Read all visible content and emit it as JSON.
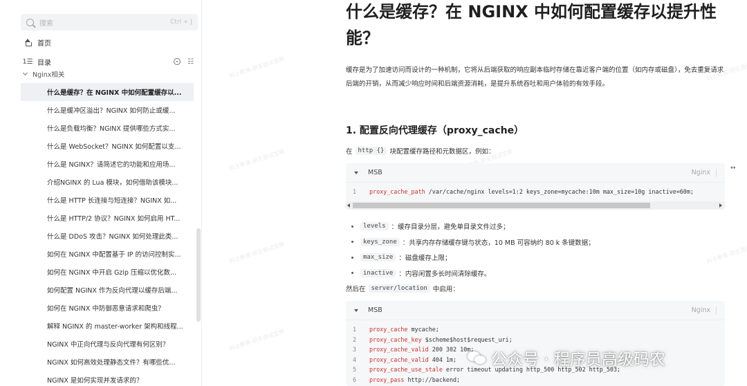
{
  "sidebar": {
    "search_placeholder": "搜索",
    "search_shortcut": "Ctrl + J",
    "home_label": "首页",
    "toc_label": "目录",
    "group_label": "Nginx相关",
    "items": [
      {
        "label": "什么是缓存？在 NGINX 中如何配置缓存以...",
        "active": true
      },
      {
        "label": "什么是缓冲区溢出？NGINX 如何防止或缓..."
      },
      {
        "label": "什么是负载均衡？NGINX 提供哪些方式实..."
      },
      {
        "label": "什么是 WebSocket？NGINX 如何配置以支..."
      },
      {
        "label": "什么是 NGINX？请简述它的功能和应用场..."
      },
      {
        "label": "介绍NGINX 的 Lua 模块，如何借助该模块..."
      },
      {
        "label": "什么是 HTTP 长连接与短连接？NGINX 如..."
      },
      {
        "label": "什么是 HTTP/2 协议？NGINX 如何启用 HT..."
      },
      {
        "label": "什么是 DDoS 攻击？NGINX 如何处理此类..."
      },
      {
        "label": "如何在 NGINX 中配置基于 IP 的访问控制实..."
      },
      {
        "label": "如何在 NGINX 中开启 Gzip 压缩以优化数..."
      },
      {
        "label": "如何配置 NGINX 作为反向代理以缓存后端..."
      },
      {
        "label": "如何在 NGINX 中防御恶意请求和爬虫？"
      },
      {
        "label": "解释 NGINX 的 master-worker 架构和线程..."
      },
      {
        "label": "NGINX 中正向代理与反向代理有何区别？"
      },
      {
        "label": "NGINX 如何高效处理静态文件？有哪些优..."
      },
      {
        "label": "NGINX 是如何实现并发请求的？"
      }
    ]
  },
  "watermark_text": "科士教育-研生面试宝典",
  "article": {
    "title": "什么是缓存？在 NGINX 中如何配置缓存以提升性能？",
    "intro": "缓存是为了加速访问而设计的一种机制，它将从后端获取的响应副本临时存储在靠近客户端的位置（如内存或磁盘），免去重复请求后端的开销，从而减少响应时间和后端资源消耗，是提升系统吞吐和用户体验的有效手段。",
    "section1_heading": "1. 配置反向代理缓存（proxy_cache）",
    "line1_prefix": "在",
    "line1_code": "http {}",
    "line1_suffix": "块配置缓存路径和元数据区，例如：",
    "code1": {
      "name": "MSB",
      "lang": "Nginx",
      "lines": [
        {
          "no": "1",
          "kw": "proxy_cache_path",
          "rest": " /var/cache/nginx levels=1:2 keys_zone=mycache:10m max_size=10g inactive=60m;"
        }
      ]
    },
    "bullets": [
      {
        "code": "levels",
        "text": "：缓存目录分层，避免单目录文件过多；"
      },
      {
        "code": "keys_zone",
        "text": "：共享内存存储缓存键与状态，10 MB 可容纳约 80 k 条键数据；"
      },
      {
        "code": "max_size",
        "text": "：磁盘缓存上限；"
      },
      {
        "code": "inactive",
        "text": "：内容闲置多长时间清除缓存。"
      }
    ],
    "line2_prefix": "然后在",
    "line2_code": "server/location",
    "line2_suffix": "中启用：",
    "code2": {
      "name": "MSB",
      "lang": "Nginx",
      "lines": [
        {
          "no": "1",
          "kw": "proxy_cache",
          "rest": " mycache;"
        },
        {
          "no": "2",
          "kw": "proxy_cache_key",
          "rest": " $scheme$host$request_uri;"
        },
        {
          "no": "3",
          "kw": "proxy_cache_valid",
          "rest": " 200 302 10m;"
        },
        {
          "no": "4",
          "kw": "proxy_cache_valid",
          "rest": " 404 1m;"
        },
        {
          "no": "5",
          "kw": "proxy_cache_use_stale",
          "rest": " error timeout updating http_500 http_502 http_503;"
        },
        {
          "no": "6",
          "kw": "proxy_pass",
          "rest": " http://backend;"
        }
      ]
    }
  },
  "brand_overlay": "公众号 · 程序员高级码农",
  "side_icon": "↔"
}
